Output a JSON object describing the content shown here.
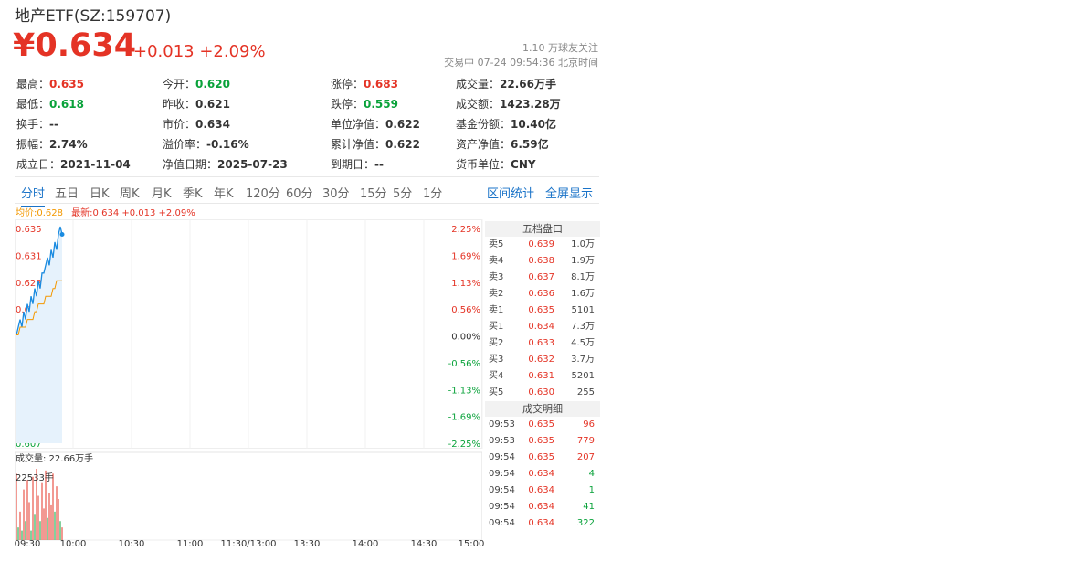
{
  "header": {
    "title": "地产ETF(SZ:159707)",
    "price": "¥0.634",
    "change": "+0.013 +2.09%",
    "followers": "1.10 万球友关注",
    "status": "交易中 07-24 09:54:36 北京时间"
  },
  "stats": [
    [
      {
        "label": "最高：",
        "value": "0.635",
        "color": "red"
      },
      {
        "label": "今开：",
        "value": "0.620",
        "color": "green"
      },
      {
        "label": "涨停：",
        "value": "0.683",
        "color": "red"
      },
      {
        "label": "成交量：",
        "value": "22.66万手",
        "color": ""
      }
    ],
    [
      {
        "label": "最低：",
        "value": "0.618",
        "color": "green"
      },
      {
        "label": "昨收：",
        "value": "0.621",
        "color": ""
      },
      {
        "label": "跌停：",
        "value": "0.559",
        "color": "green"
      },
      {
        "label": "成交额：",
        "value": "1423.28万",
        "color": ""
      }
    ],
    [
      {
        "label": "换手：",
        "value": "--",
        "color": ""
      },
      {
        "label": "市价：",
        "value": "0.634",
        "color": ""
      },
      {
        "label": "单位净值：",
        "value": "0.622",
        "color": ""
      },
      {
        "label": "基金份额：",
        "value": "10.40亿",
        "color": ""
      }
    ],
    [
      {
        "label": "振幅：",
        "value": "2.74%",
        "color": ""
      },
      {
        "label": "溢价率：",
        "value": "-0.16%",
        "color": ""
      },
      {
        "label": "累计净值：",
        "value": "0.622",
        "color": ""
      },
      {
        "label": "资产净值：",
        "value": "6.59亿",
        "color": ""
      }
    ],
    [
      {
        "label": "成立日：",
        "value": "2021-11-04",
        "color": ""
      },
      {
        "label": "净值日期：",
        "value": "2025-07-23",
        "color": ""
      },
      {
        "label": "到期日：",
        "value": "--",
        "color": ""
      },
      {
        "label": "货币单位：",
        "value": "CNY",
        "color": ""
      }
    ]
  ],
  "tabs": [
    "分时",
    "五日",
    "日K",
    "周K",
    "月K",
    "季K",
    "年K",
    "120分",
    "60分",
    "30分",
    "15分",
    "5分",
    "1分"
  ],
  "tab_links": [
    "区间统计",
    "全屏显示"
  ],
  "legend": {
    "avg": "均价:0.628",
    "last": "最新:0.634 +0.013 +2.09%"
  },
  "volume_label": "成交量: 22.66万手",
  "volume_max": "22533手",
  "order_book": {
    "title": "五档盘口",
    "asks": [
      {
        "level": "卖5",
        "price": "0.639",
        "volume": "1.0万"
      },
      {
        "level": "卖4",
        "price": "0.638",
        "volume": "1.9万"
      },
      {
        "level": "卖3",
        "price": "0.637",
        "volume": "8.1万"
      },
      {
        "level": "卖2",
        "price": "0.636",
        "volume": "1.6万"
      },
      {
        "level": "卖1",
        "price": "0.635",
        "volume": "5101"
      }
    ],
    "bids": [
      {
        "level": "买1",
        "price": "0.634",
        "volume": "7.3万"
      },
      {
        "level": "买2",
        "price": "0.633",
        "volume": "4.5万"
      },
      {
        "level": "买3",
        "price": "0.632",
        "volume": "3.7万"
      },
      {
        "level": "买4",
        "price": "0.631",
        "volume": "5201"
      },
      {
        "level": "买5",
        "price": "0.630",
        "volume": "255"
      }
    ]
  },
  "trades": {
    "title": "成交明细",
    "rows": [
      {
        "time": "09:53",
        "price": "0.635",
        "volume": "96",
        "side": "red"
      },
      {
        "time": "09:53",
        "price": "0.635",
        "volume": "779",
        "side": "red"
      },
      {
        "time": "09:54",
        "price": "0.635",
        "volume": "207",
        "side": "red"
      },
      {
        "time": "09:54",
        "price": "0.634",
        "volume": "4",
        "side": "green"
      },
      {
        "time": "09:54",
        "price": "0.634",
        "volume": "1",
        "side": "green"
      },
      {
        "time": "09:54",
        "price": "0.634",
        "volume": "41",
        "side": "green"
      },
      {
        "time": "09:54",
        "price": "0.634",
        "volume": "322",
        "side": "green"
      }
    ]
  },
  "colors": {
    "up": "#e43325",
    "down": "#09a23a",
    "price_line": "#1a8be0",
    "avg_line": "#f39800",
    "accent": "#1a73c8"
  },
  "chart_data": {
    "type": "line",
    "y_ticks_left": [
      "0.635",
      "0.631",
      "0.628",
      "0.625",
      "0.621",
      "0.617",
      "0.614",
      "0.611",
      "0.607"
    ],
    "y_ticks_right": [
      "2.25%",
      "1.69%",
      "1.13%",
      "0.56%",
      "0.00%",
      "-0.56%",
      "-1.13%",
      "-1.69%",
      "-2.25%"
    ],
    "ylim": [
      0.607,
      0.635
    ],
    "x_ticks": [
      "09:30",
      "10:00",
      "10:30",
      "11:00",
      "11:30/13:00",
      "13:30",
      "14:00",
      "14:30",
      "15:00"
    ],
    "price_series": [
      0.621,
      0.622,
      0.623,
      0.622,
      0.624,
      0.623,
      0.625,
      0.624,
      0.626,
      0.625,
      0.627,
      0.626,
      0.628,
      0.627,
      0.629,
      0.629,
      0.63,
      0.631,
      0.63,
      0.632,
      0.631,
      0.633,
      0.632,
      0.634,
      0.635,
      0.634
    ],
    "avg_series": [
      0.621,
      0.621,
      0.622,
      0.622,
      0.622,
      0.622,
      0.623,
      0.623,
      0.623,
      0.623,
      0.624,
      0.624,
      0.625,
      0.625,
      0.625,
      0.625,
      0.626,
      0.626,
      0.626,
      0.626,
      0.627,
      0.627,
      0.628,
      0.628,
      0.628,
      0.628
    ],
    "volume_series": [
      21000,
      4000,
      9000,
      3000,
      16000,
      6000,
      19000,
      12000,
      3000,
      20000,
      8000,
      22533,
      14000,
      6000,
      18000,
      10000,
      22000,
      7000,
      15000,
      11000,
      21000,
      9000,
      17000,
      13000,
      6000,
      4000
    ],
    "volume_colors": [
      "red",
      "green",
      "red",
      "green",
      "red",
      "green",
      "red",
      "red",
      "green",
      "red",
      "green",
      "red",
      "red",
      "green",
      "red",
      "red",
      "red",
      "green",
      "red",
      "red",
      "red",
      "green",
      "red",
      "red",
      "green",
      "red"
    ]
  }
}
